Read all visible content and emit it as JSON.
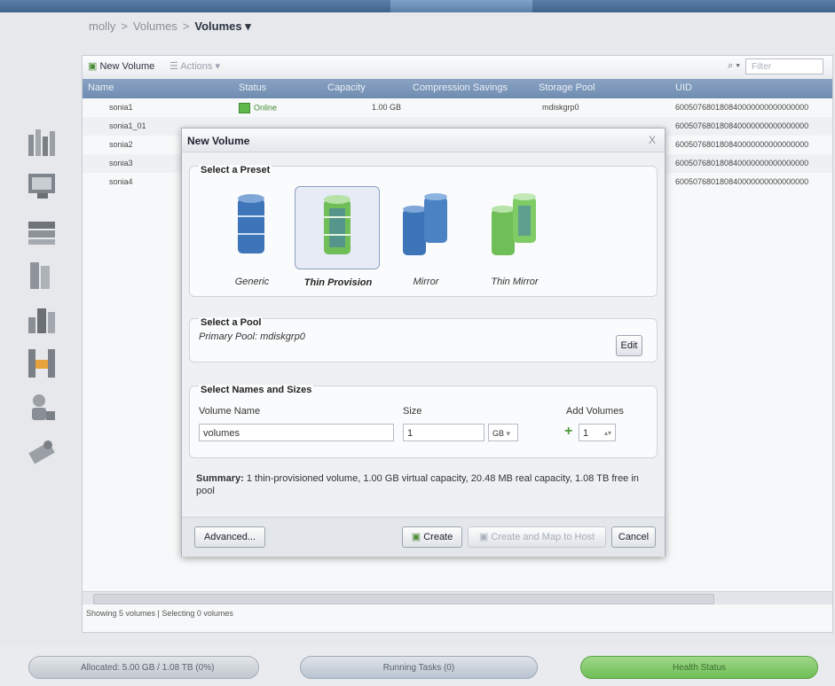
{
  "breadcrumb": {
    "root": "molly",
    "parent": "Volumes",
    "current": "Volumes ▾"
  },
  "toolbar": {
    "new_volume": "New Volume",
    "actions": "Actions ▾",
    "filter_placeholder": "Filter"
  },
  "table": {
    "headers": [
      "Name",
      "Status",
      "Capacity",
      "Compression Savings",
      "Storage Pool",
      "UID"
    ],
    "rows": [
      {
        "name": "sonia1",
        "status": "Online",
        "capacity": "1.00 GB",
        "pool": "mdiskgrp0",
        "uid": "600507680180840000000000000000"
      },
      {
        "name": "sonia1_01",
        "uid": "600507680180840000000000000000"
      },
      {
        "name": "sonia2",
        "uid": "600507680180840000000000000000"
      },
      {
        "name": "sonia3",
        "uid": "600507680180840000000000000000"
      },
      {
        "name": "sonia4",
        "uid": "600507680180840000000000000000"
      }
    ]
  },
  "status_line": "Showing 5 volumes | Selecting 0 volumes",
  "dock": {
    "allocated": "Allocated: 5.00 GB / 1.08 TB (0%)",
    "running_tasks": "Running Tasks (0)",
    "health_status": "Health Status"
  },
  "dialog": {
    "title": "New Volume",
    "close": "X",
    "preset_section": "Select a Preset",
    "presets": [
      {
        "label": "Generic",
        "selected": false,
        "color": "#3e74b8"
      },
      {
        "label": "Thin Provision",
        "selected": true,
        "color": "#6fbe57"
      },
      {
        "label": "Mirror",
        "selected": false,
        "color": "#3e74b8"
      },
      {
        "label": "Thin Mirror",
        "selected": false,
        "color": "#6fbe57"
      }
    ],
    "pool_section": "Select a Pool",
    "primary_pool": "Primary Pool: mdiskgrp0",
    "edit": "Edit",
    "names_section": "Select Names and Sizes",
    "volume_name_label": "Volume Name",
    "volume_name_value": "volumes",
    "size_label": "Size",
    "size_value": "1",
    "size_unit": "GB",
    "add_volumes_label": "Add Volumes",
    "add_volumes_value": "1",
    "summary_label": "Summary:",
    "summary_text": "1 thin-provisioned volume, 1.00 GB virtual capacity, 20.48 MB real capacity, 1.08 TB free in pool",
    "advanced": "Advanced...",
    "create": "Create",
    "create_map": "Create and Map to Host",
    "cancel": "Cancel"
  }
}
